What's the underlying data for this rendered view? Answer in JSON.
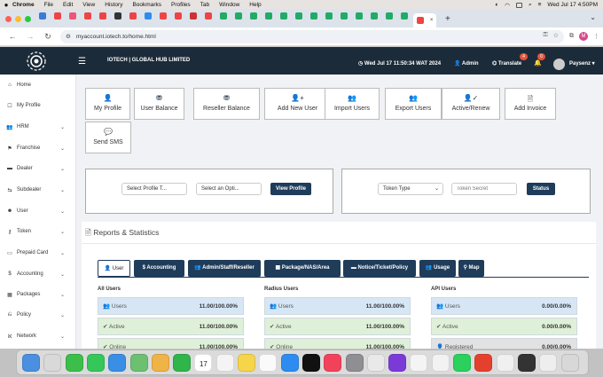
{
  "menubar": {
    "items": [
      "Chrome",
      "File",
      "Edit",
      "View",
      "History",
      "Bookmarks",
      "Profiles",
      "Tab",
      "Window",
      "Help"
    ],
    "clock": "Wed Jul 17  4:50PM"
  },
  "browser": {
    "url": "myaccount.iotech.to/home.html",
    "tab_colors": [
      "#3a7bd5",
      "#e44",
      "#e57",
      "#e44",
      "#e44",
      "#333",
      "#e44",
      "#2d8cf0",
      "#e44",
      "#e44",
      "#c33",
      "#e44",
      "#2a6",
      "#2a6",
      "#2a6",
      "#2a6",
      "#2a6",
      "#2a6",
      "#2a6",
      "#2a6",
      "#2a6",
      "#2a6",
      "#2a6",
      "#2a6",
      "#2a6",
      "#e44"
    ],
    "profile_initial": "M"
  },
  "header": {
    "company": "IOTECH | GLOBAL HUB LIMITED",
    "datetime": "Wed Jul 17 11:50:34 WAT 2024",
    "admin": "Admin",
    "translate": "Translate",
    "translate_badge": "4",
    "bell_badge": "0",
    "username": "Paysenz"
  },
  "sidebar": {
    "items": [
      {
        "label": "Home",
        "icon": "home-icon",
        "glyph": "⌂",
        "chevron": false
      },
      {
        "label": "My Profile",
        "icon": "profile-icon",
        "glyph": "☐",
        "chevron": false
      },
      {
        "label": "HRM",
        "icon": "users-icon",
        "glyph": "👥",
        "chevron": true
      },
      {
        "label": "Franchise",
        "icon": "franchise-icon",
        "glyph": "⚑",
        "chevron": true
      },
      {
        "label": "Dealer",
        "icon": "dealer-icon",
        "glyph": "▬",
        "chevron": true
      },
      {
        "label": "Subdealer",
        "icon": "subdealer-icon",
        "glyph": "⇆",
        "chevron": true
      },
      {
        "label": "User",
        "icon": "user-icon",
        "glyph": "☻",
        "chevron": true
      },
      {
        "label": "Token",
        "icon": "token-icon",
        "glyph": "⚷",
        "chevron": true
      },
      {
        "label": "Prepaid Card",
        "icon": "card-icon",
        "glyph": "▭",
        "chevron": true
      },
      {
        "label": "Accounting",
        "icon": "dollar-icon",
        "glyph": "$",
        "chevron": true
      },
      {
        "label": "Packages",
        "icon": "packages-icon",
        "glyph": "▦",
        "chevron": true
      },
      {
        "label": "Policy",
        "icon": "policy-icon",
        "glyph": "⎌",
        "chevron": true
      },
      {
        "label": "Network",
        "icon": "network-icon",
        "glyph": "ℵ",
        "chevron": true
      }
    ]
  },
  "quick_actions": [
    {
      "label": "My Profile",
      "icon": "user-icon",
      "glyph": "👤"
    },
    {
      "label": "User Balance",
      "icon": "balance-icon",
      "glyph": "⛃"
    },
    {
      "label": "Reseller Balance",
      "icon": "coins-icon",
      "glyph": "⛃"
    },
    {
      "label": "Add New User",
      "icon": "user-plus-icon",
      "glyph": "👤+"
    },
    {
      "label": "Import Users",
      "icon": "import-users-icon",
      "glyph": "👥"
    },
    {
      "label": "Export Users",
      "icon": "export-users-icon",
      "glyph": "👥"
    },
    {
      "label": "Active/Renew",
      "icon": "user-check-icon",
      "glyph": "👤✓"
    },
    {
      "label": "Add Invoice",
      "icon": "invoice-icon",
      "glyph": "🗎"
    },
    {
      "label": "Send SMS",
      "icon": "sms-icon",
      "glyph": "💬"
    }
  ],
  "profile_filter": {
    "select_profile": "Select Profile T...",
    "select_option": "Select an Opti...",
    "button": "View Profile"
  },
  "token_filter": {
    "token_type": "Token Type",
    "token_secret_placeholder": "Token Secret",
    "button": "Status"
  },
  "reports": {
    "title": "Reports & Statistics",
    "tabs": [
      {
        "label": "User",
        "glyph": "👤",
        "icon": "user-icon"
      },
      {
        "label": "Accounting",
        "glyph": "$",
        "icon": "dollar-icon"
      },
      {
        "label": "Admin/Staff/Reseller",
        "glyph": "👥",
        "icon": "staff-icon"
      },
      {
        "label": "Package/NAS/Area",
        "glyph": "▦",
        "icon": "package-icon"
      },
      {
        "label": "Notice/Ticket/Policy",
        "glyph": "▬",
        "icon": "notice-icon"
      },
      {
        "label": "Usage",
        "glyph": "👥",
        "icon": "usage-icon"
      },
      {
        "label": "Map",
        "glyph": "⚲",
        "icon": "map-pin-icon"
      }
    ],
    "columns": [
      {
        "title": "All Users",
        "rows": [
          {
            "label": "Users",
            "value": "11.00/100.00%",
            "color": "blue",
            "glyph": "👥"
          },
          {
            "label": "Active",
            "value": "11.00/100.00%",
            "color": "green",
            "glyph": "✔"
          },
          {
            "label": "Online",
            "value": "11.00/100.00%",
            "color": "green",
            "glyph": "✔"
          }
        ]
      },
      {
        "title": "Radius Users",
        "rows": [
          {
            "label": "Users",
            "value": "11.00/100.00%",
            "color": "blue",
            "glyph": "👥"
          },
          {
            "label": "Active",
            "value": "11.00/100.00%",
            "color": "green",
            "glyph": "✔"
          },
          {
            "label": "Online",
            "value": "11.00/100.00%",
            "color": "green",
            "glyph": "✔"
          }
        ]
      },
      {
        "title": "API Users",
        "rows": [
          {
            "label": "Users",
            "value": "0.00/0.00%",
            "color": "blue",
            "glyph": "👥"
          },
          {
            "label": "Active",
            "value": "0.00/0.00%",
            "color": "green",
            "glyph": "✔"
          },
          {
            "label": "Registered",
            "value": "0.00/0.00%",
            "color": "grey",
            "glyph": "👤"
          }
        ]
      }
    ]
  },
  "dock": {
    "date_badge": "17",
    "icons": [
      {
        "name": "finder-icon",
        "color": "#4a8fe0"
      },
      {
        "name": "launchpad-icon",
        "color": "#d9d9d9"
      },
      {
        "name": "facetime-icon",
        "color": "#3bbf4a"
      },
      {
        "name": "messages-icon",
        "color": "#35c759"
      },
      {
        "name": "mail-icon",
        "color": "#3a8ee6"
      },
      {
        "name": "maps-icon",
        "color": "#6cc070"
      },
      {
        "name": "photos-icon",
        "color": "#f0b347"
      },
      {
        "name": "facetime2-icon",
        "color": "#2fb54a"
      },
      {
        "name": "calendar-icon",
        "color": "#ffffff"
      },
      {
        "name": "reminders-icon",
        "color": "#f4f4f4"
      },
      {
        "name": "notes-icon",
        "color": "#f7d54a"
      },
      {
        "name": "freeform-icon",
        "color": "#fafafa"
      },
      {
        "name": "appstore-icon",
        "color": "#2d8cf0"
      },
      {
        "name": "tv-icon",
        "color": "#111111"
      },
      {
        "name": "music-icon",
        "color": "#f2425b"
      },
      {
        "name": "settings-icon",
        "color": "#8e8e93"
      },
      {
        "name": "mysql-icon",
        "color": "#e9e9e9"
      },
      {
        "name": "phpstorm-icon",
        "color": "#7b3ad8"
      },
      {
        "name": "textedit-icon",
        "color": "#f4f4f4"
      },
      {
        "name": "chrome-icon",
        "color": "#f2f2f2"
      },
      {
        "name": "whatsapp-icon",
        "color": "#2ad15d"
      },
      {
        "name": "anydesk-icon",
        "color": "#e5402e"
      },
      {
        "name": "document-icon",
        "color": "#f0f0f0"
      },
      {
        "name": "screen-icon",
        "color": "#333333"
      },
      {
        "name": "screenshot-icon",
        "color": "#eeeeee"
      },
      {
        "name": "trash-icon",
        "color": "#d8d8d8"
      }
    ]
  }
}
